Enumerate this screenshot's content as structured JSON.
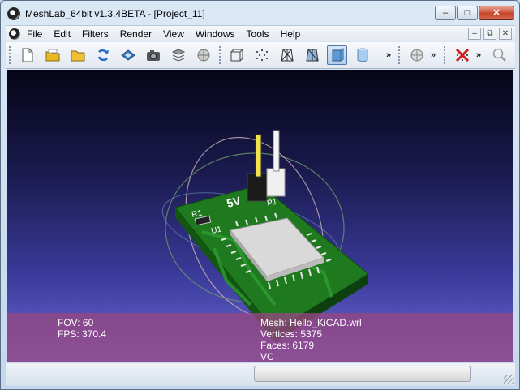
{
  "window": {
    "title": "MeshLab_64bit v1.3.4BETA - [Project_11]",
    "controls": {
      "minimize": "–",
      "maximize": "□",
      "close": "✕"
    }
  },
  "menubar": {
    "items": [
      "File",
      "Edit",
      "Filters",
      "Render",
      "View",
      "Windows",
      "Tools",
      "Help"
    ],
    "mdi": {
      "minimize": "–",
      "restore": "⧉",
      "close": "✕"
    }
  },
  "toolbar": {
    "icons": [
      "new-project-icon",
      "open-project-icon",
      "open-mesh-icon",
      "reload-icon",
      "save-icon",
      "snapshot-icon",
      "layers-icon",
      "hidden-icon",
      "bounding-box-icon",
      "points-icon",
      "wireframe-icon",
      "hidden-lines-icon",
      "flat-shading-icon",
      "smooth-shading-icon",
      "lighting-icon",
      "delete-icon",
      "zoom-icon"
    ],
    "more_glyph": "»"
  },
  "viewport": {
    "info_left": {
      "fov": "FOV: 60",
      "fps": "FPS:   370.4"
    },
    "info_right": {
      "mesh": "Mesh: Hello_KiCAD.wrl",
      "vertices": "Vertices: 5375",
      "faces": "Faces: 6179",
      "vc": "VC"
    },
    "board_labels": {
      "voltage": "5V",
      "r1": "R1",
      "u1": "U1",
      "p1": "P1"
    },
    "colors": {
      "pcb": "#1f7a1f",
      "chip": "#d9d9d9",
      "background_top": "#050517",
      "background_bottom": "#6c6cd8"
    }
  },
  "statusbar": {
    "progress_percent": 0
  }
}
